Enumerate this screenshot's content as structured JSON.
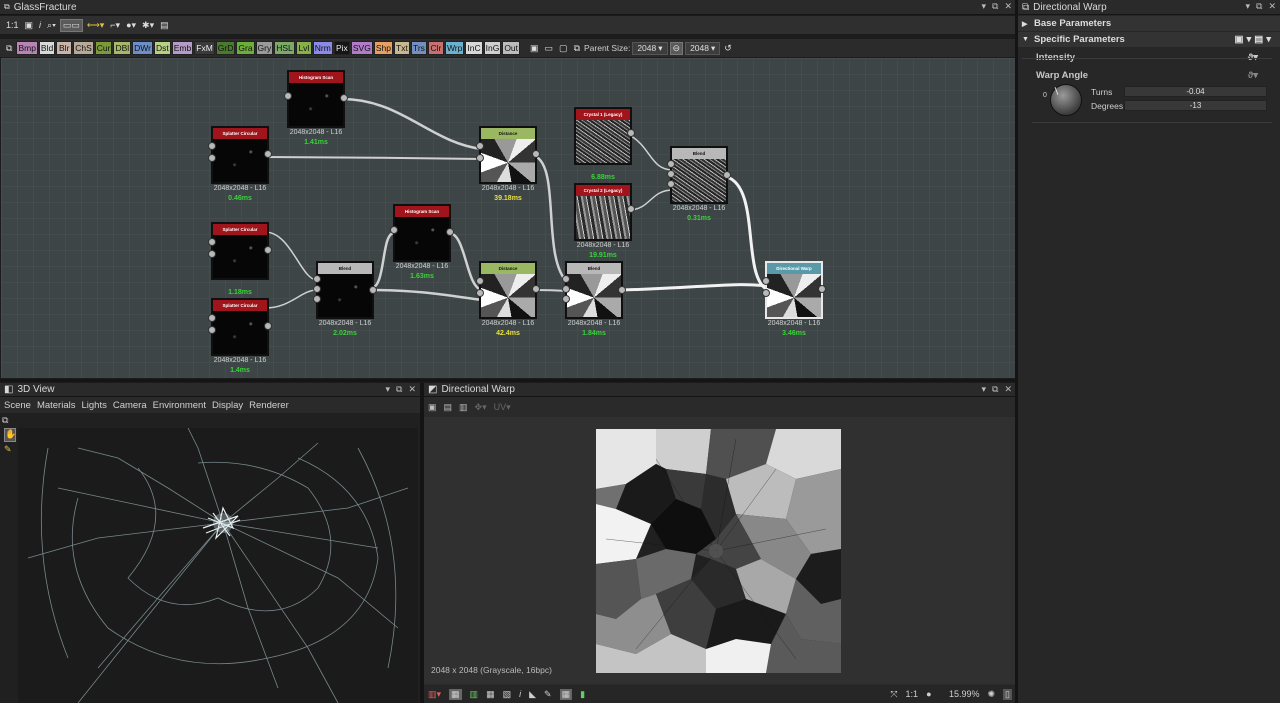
{
  "app": {
    "title": "GlassFracture",
    "toolbar_icons": [
      "home-icon",
      "frame-icon",
      "info-icon",
      "zoom-icon",
      "layout-icon",
      "link-icon",
      "branch-icon",
      "flame-icon",
      "gear-icon",
      "export-icon"
    ],
    "zoom_label": "1:1"
  },
  "graph_toolbar": {
    "nodes": [
      {
        "label": "Bmp",
        "color": "#b784b4"
      },
      {
        "label": "Bld",
        "color": "#d9d9d9"
      },
      {
        "label": "Blr",
        "color": "#c8b4a8"
      },
      {
        "label": "ChS",
        "color": "#b8a898"
      },
      {
        "label": "Cur",
        "color": "#7c9a3c"
      },
      {
        "label": "DBl",
        "color": "#a5b868"
      },
      {
        "label": "DWr",
        "color": "#6c8fc8"
      },
      {
        "label": "Dst",
        "color": "#b8d084"
      },
      {
        "label": "Emb",
        "color": "#b49cc8"
      },
      {
        "label": "FxM",
        "color": "#3a3a3a"
      },
      {
        "label": "GrD",
        "color": "#4a7a2e"
      },
      {
        "label": "Gra",
        "color": "#6cae3a"
      },
      {
        "label": "Gry",
        "color": "#9a9a9a"
      },
      {
        "label": "HSL",
        "color": "#7ca868"
      },
      {
        "label": "Lvl",
        "color": "#88b048"
      },
      {
        "label": "Nrm",
        "color": "#8a8ae8"
      },
      {
        "label": "Pix",
        "color": "#151515"
      },
      {
        "label": "SVG",
        "color": "#b07cc8"
      },
      {
        "label": "Shp",
        "color": "#e8a060"
      },
      {
        "label": "Txt",
        "color": "#c8b890"
      },
      {
        "label": "Trs",
        "color": "#7490c0"
      },
      {
        "label": "Clr",
        "color": "#c87070"
      },
      {
        "label": "Wrp",
        "color": "#6cb0d0"
      },
      {
        "label": "InC",
        "color": "#d8d8d8"
      },
      {
        "label": "InG",
        "color": "#d0d0d0"
      },
      {
        "label": "Out",
        "color": "#bcbcbc"
      }
    ],
    "parent_size_label": "Parent Size:",
    "parent_size_value": "2048",
    "size_value": "2048"
  },
  "graph_nodes": [
    {
      "id": "splatter1",
      "title": "Splatter Circular",
      "res": "2048x2048 - L16",
      "time": "0.46ms",
      "time_color": "#39d339",
      "header": "#a0141c"
    },
    {
      "id": "histo1",
      "title": "Histogram Scan",
      "res": "2048x2048 - L16",
      "time": "1.41ms",
      "time_color": "#39d339",
      "header": "#a0141c"
    },
    {
      "id": "dist1",
      "title": "Distance",
      "res": "2048x2048 - L16",
      "time": "39.18ms",
      "time_color": "#e8e040",
      "header": "#9ab862"
    },
    {
      "id": "crystal1",
      "title": "Crystal 1 (Legacy)",
      "res": "",
      "time": "6.88ms",
      "time_color": "#39d339",
      "header": "#a0141c"
    },
    {
      "id": "crystal2",
      "title": "Crystal 2 (Legacy)",
      "res": "2048x2048 - L16",
      "time": "19.91ms",
      "time_color": "#39d339",
      "header": "#a0141c"
    },
    {
      "id": "blend1",
      "title": "Blend",
      "res": "2048x2048 - L16",
      "time": "0.31ms",
      "time_color": "#39d339",
      "header": "#b8b8b8"
    },
    {
      "id": "splatter2",
      "title": "Splatter Circular",
      "res": "",
      "time": "1.18ms",
      "time_color": "#39d339",
      "header": "#a0141c"
    },
    {
      "id": "splatter3",
      "title": "Splatter Circular",
      "res": "2048x2048 - L16",
      "time": "1.4ms",
      "time_color": "#39d339",
      "header": "#a0141c"
    },
    {
      "id": "blend2",
      "title": "Blend",
      "res": "2048x2048 - L16",
      "time": "2.02ms",
      "time_color": "#39d339",
      "header": "#b8b8b8"
    },
    {
      "id": "histo2",
      "title": "Histogram Scan",
      "res": "2048x2048 - L16",
      "time": "1.63ms",
      "time_color": "#39d339",
      "header": "#a0141c"
    },
    {
      "id": "dist2",
      "title": "Distance",
      "res": "2048x2048 - L16",
      "time": "42.4ms",
      "time_color": "#e8e040",
      "header": "#9ab862"
    },
    {
      "id": "blend3",
      "title": "Blend",
      "res": "2048x2048 - L16",
      "time": "1.84ms",
      "time_color": "#39d339",
      "header": "#b8b8b8"
    },
    {
      "id": "dirwarp",
      "title": "Directional Warp",
      "res": "2048x2048 - L16",
      "time": "3.46ms",
      "time_color": "#39d339",
      "header": "#5a9aa8"
    }
  ],
  "view3d": {
    "title": "3D View",
    "menu": [
      "Scene",
      "Materials",
      "Lights",
      "Camera",
      "Environment",
      "Display",
      "Renderer"
    ]
  },
  "view2d": {
    "title": "Directional Warp",
    "status": "2048 x 2048 (Grayscale, 16bpc)",
    "zoom": "15.99%",
    "ratio": "1:1"
  },
  "properties": {
    "title": "Directional Warp",
    "sections": [
      "Base Parameters",
      "Specific Parameters"
    ],
    "intensity_label": "Intensity",
    "warp_angle_label": "Warp Angle",
    "dial_zero": "0",
    "turns_label": "Turns",
    "turns_value": "-0.04",
    "degrees_label": "Degrees",
    "degrees_value": "-13"
  }
}
